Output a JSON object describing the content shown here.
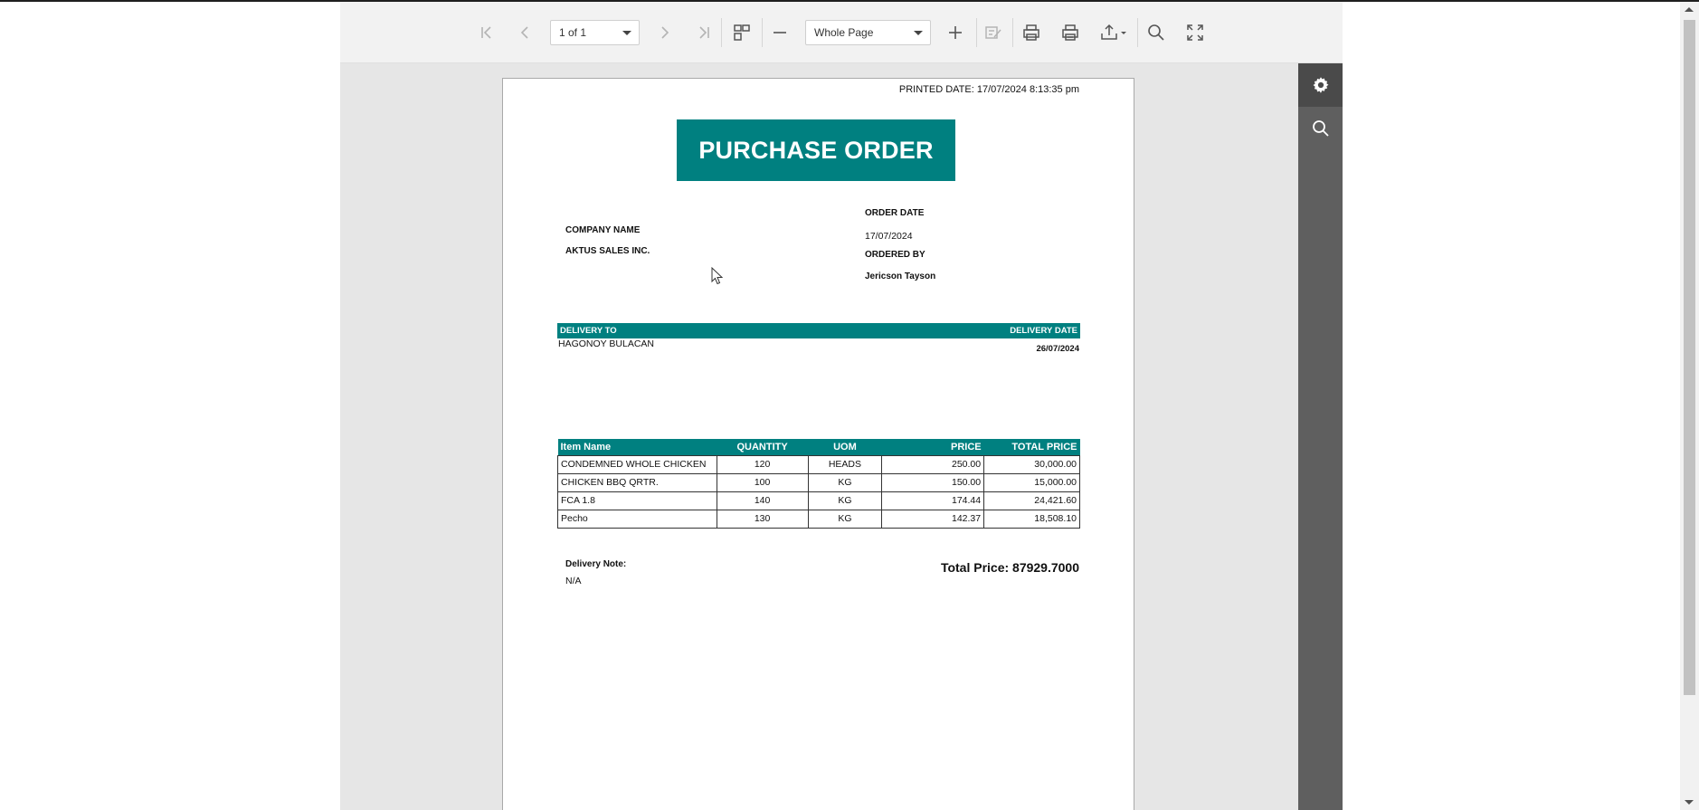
{
  "toolbar": {
    "page_indicator": "1 of 1",
    "zoom_value": "Whole Page",
    "icons": [
      "first-page-icon",
      "prev-page-icon",
      "next-page-icon",
      "last-page-icon",
      "multipage-icon",
      "zoom-out-icon",
      "zoom-in-icon",
      "edit-fields-icon",
      "print-icon",
      "print-page-icon",
      "export-icon",
      "search-icon",
      "fullscreen-icon"
    ]
  },
  "sidepanel": {
    "icons": [
      "settings-icon",
      "search-icon"
    ]
  },
  "document": {
    "printed_date": "PRINTED DATE: 17/07/2024 8:13:35 pm",
    "title": "PURCHASE ORDER",
    "company_label": "COMPANY NAME",
    "company_name": "AKTUS SALES INC.",
    "order_date_label": "ORDER DATE",
    "order_date": "17/07/2024",
    "ordered_by_label": "ORDERED BY",
    "ordered_by": "Jericson Tayson",
    "delivery_to_label": "DELIVERY TO",
    "delivery_date_label": "DELIVERY DATE",
    "delivery_to": "HAGONOY BULACAN",
    "delivery_date": "26/07/2024",
    "table_headers": [
      "Item Name",
      "QUANTITY",
      "UOM",
      "PRICE",
      "TOTAL PRICE"
    ],
    "items": [
      [
        "CONDEMNED WHOLE CHICKEN",
        "120",
        "HEADS",
        "250.00",
        "30,000.00"
      ],
      [
        "CHICKEN BBQ QRTR.",
        "100",
        "KG",
        "150.00",
        "15,000.00"
      ],
      [
        "FCA 1.8",
        "140",
        "KG",
        "174.44",
        "24,421.60"
      ],
      [
        "Pecho",
        "130",
        "KG",
        "142.37",
        "18,508.10"
      ]
    ],
    "delivery_note_label": "Delivery Note:",
    "delivery_note": "N/A",
    "total_price": "Total Price: 87929.7000"
  },
  "colors": {
    "accent": "#008080",
    "panel": "#5f5f5f",
    "viewer_bg": "#e6e6e6"
  }
}
